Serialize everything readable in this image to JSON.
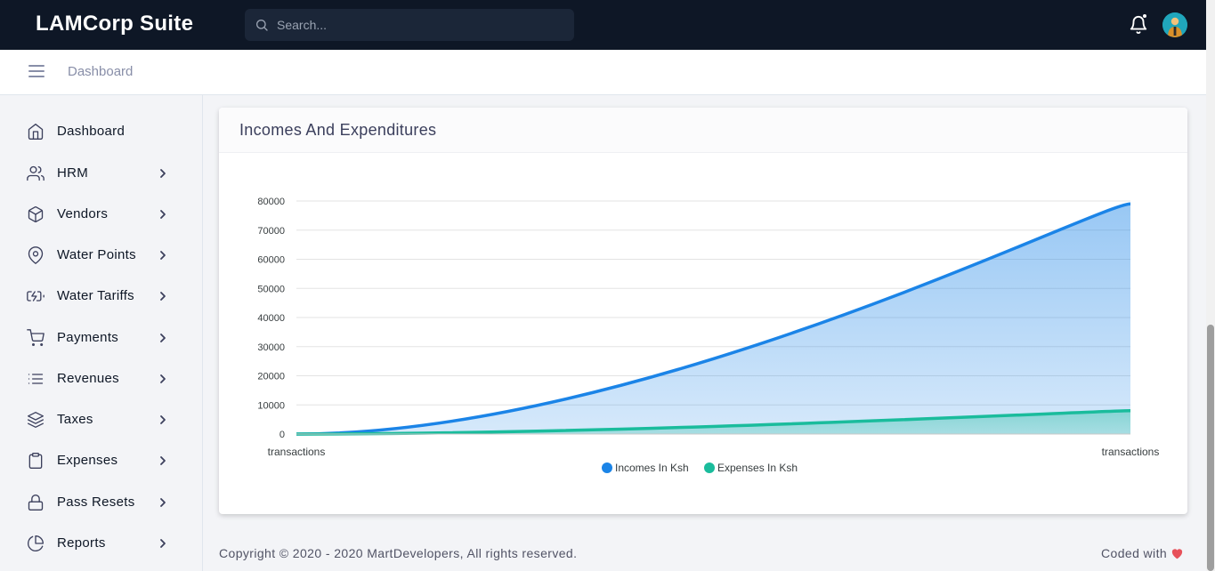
{
  "header": {
    "brand": "LAMCorp Suite",
    "search_placeholder": "Search...",
    "icons": [
      "search-icon",
      "bell-icon",
      "user-avatar"
    ]
  },
  "breadcrumb": {
    "current": "Dashboard"
  },
  "sidebar": {
    "items": [
      {
        "label": "Dashboard",
        "icon": "home-icon",
        "has_children": false
      },
      {
        "label": "HRM",
        "icon": "users-icon",
        "has_children": true
      },
      {
        "label": "Vendors",
        "icon": "box-icon",
        "has_children": true
      },
      {
        "label": "Water Points",
        "icon": "map-pin-icon",
        "has_children": true
      },
      {
        "label": "Water Tariffs",
        "icon": "battery-charging-icon",
        "has_children": true
      },
      {
        "label": "Payments",
        "icon": "shopping-cart-icon",
        "has_children": true
      },
      {
        "label": "Revenues",
        "icon": "list-icon",
        "has_children": true
      },
      {
        "label": "Taxes",
        "icon": "layers-icon",
        "has_children": true
      },
      {
        "label": "Expenses",
        "icon": "clipboard-icon",
        "has_children": true
      },
      {
        "label": "Pass Resets",
        "icon": "lock-icon",
        "has_children": true
      },
      {
        "label": "Reports",
        "icon": "pie-chart-icon",
        "has_children": true
      }
    ]
  },
  "card": {
    "title": "Incomes And Expenditures"
  },
  "chart_data": {
    "type": "area",
    "title": "",
    "xlabel": "",
    "ylabel": "",
    "categories": [
      "transactions",
      "transactions"
    ],
    "ylim": [
      0,
      80000
    ],
    "yticks": [
      0,
      10000,
      20000,
      30000,
      40000,
      50000,
      60000,
      70000,
      80000
    ],
    "grid": true,
    "legend_position": "bottom",
    "series": [
      {
        "name": "Incomes In Ksh",
        "color": "#1b84e7",
        "values": [
          0,
          79000
        ]
      },
      {
        "name": "Expenses In Ksh",
        "color": "#1abc9c",
        "values": [
          0,
          8000
        ]
      }
    ]
  },
  "colors": {
    "topbar": "#0e1726",
    "income": "#1b84e7",
    "expense": "#1abc9c",
    "heart": "#e7515a"
  },
  "footer": {
    "copyright": "Copyright © 2020 - 2020 MartDevelopers, All rights reserved.",
    "coded_with": "Coded with"
  }
}
